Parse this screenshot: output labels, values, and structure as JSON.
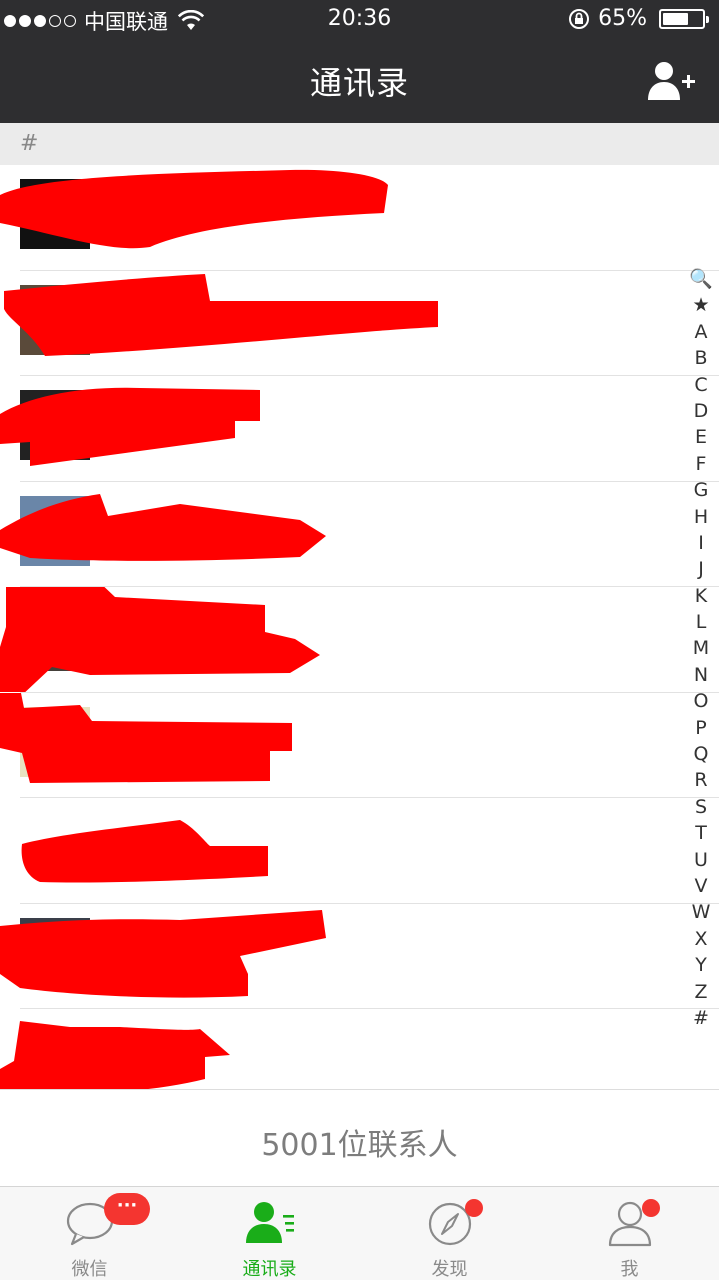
{
  "status_bar": {
    "carrier": "中国联通",
    "time": "20:36",
    "battery_percent_text": "65%",
    "battery_level": 0.65
  },
  "nav": {
    "title": "通讯录",
    "add_contact_icon": "add-contact-icon"
  },
  "section": {
    "header": "#"
  },
  "contacts": {
    "count_text": "5001位联系人",
    "redacted_row_count": 9
  },
  "index_bar": {
    "items": [
      "🔍",
      "★",
      "A",
      "B",
      "C",
      "D",
      "E",
      "F",
      "G",
      "H",
      "I",
      "J",
      "K",
      "L",
      "M",
      "N",
      "O",
      "P",
      "Q",
      "R",
      "S",
      "T",
      "U",
      "V",
      "W",
      "X",
      "Y",
      "Z",
      "#"
    ]
  },
  "tabs": [
    {
      "label": "微信",
      "icon": "chat-icon",
      "badge": "···",
      "active": false
    },
    {
      "label": "通讯录",
      "icon": "contacts-icon",
      "active": true
    },
    {
      "label": "发现",
      "icon": "compass-icon",
      "dot": true,
      "active": false
    },
    {
      "label": "我",
      "icon": "person-icon",
      "dot": true,
      "active": false
    }
  ],
  "colors": {
    "nav_bg": "#2e2e30",
    "accent_green": "#1aad19",
    "badge_red": "#f43530",
    "redaction_red": "#ff0000"
  }
}
